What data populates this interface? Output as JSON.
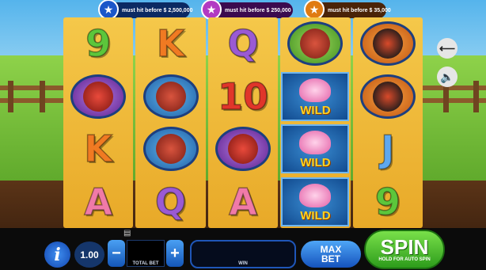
{
  "jackpots": [
    {
      "text": "must hit before $ 2,500,000",
      "color": "#1b57c9"
    },
    {
      "text": "must hit before $ 250,000",
      "color": "#b23ac2"
    },
    {
      "text": "must hit before $ 35,000",
      "color": "#e07b12"
    }
  ],
  "reels": [
    [
      {
        "type": "letter",
        "value": "9",
        "color": "green"
      },
      {
        "type": "symbol",
        "icon": "red-ant-icon"
      },
      {
        "type": "letter",
        "value": "K",
        "color": "orange"
      },
      {
        "type": "letter",
        "value": "A",
        "color": "pink"
      }
    ],
    [
      {
        "type": "letter",
        "value": "K",
        "color": "orange"
      },
      {
        "type": "symbol",
        "icon": "ant-icon"
      },
      {
        "type": "symbol",
        "icon": "ant-icon"
      },
      {
        "type": "letter",
        "value": "Q",
        "color": "purple"
      }
    ],
    [
      {
        "type": "letter",
        "value": "Q",
        "color": "purple"
      },
      {
        "type": "letter",
        "value": "10",
        "color": "red"
      },
      {
        "type": "symbol",
        "icon": "red-ant-icon"
      },
      {
        "type": "letter",
        "value": "A",
        "color": "pink"
      }
    ],
    [
      {
        "type": "symbol",
        "icon": "ant-with-lollipop-icon"
      },
      {
        "type": "wild",
        "label": "WILD"
      },
      {
        "type": "wild",
        "label": "WILD"
      },
      {
        "type": "wild",
        "label": "WILD"
      }
    ],
    [
      {
        "type": "symbol",
        "icon": "ladybug-icon"
      },
      {
        "type": "symbol",
        "icon": "ladybug-icon"
      },
      {
        "type": "letter",
        "value": "J",
        "color": "blue"
      },
      {
        "type": "letter",
        "value": "9",
        "color": "green"
      }
    ]
  ],
  "controls": {
    "info_label": "i",
    "bet_value": "1.00",
    "minus_label": "−",
    "plus_label": "+",
    "total_bet_label": "TOTAL BET",
    "win_label": "WIN",
    "max_bet_line1": "MAX",
    "max_bet_line2": "BET",
    "spin_label": "SPIN",
    "spin_sub": "HOLD FOR AUTO SPIN"
  },
  "side": {
    "back_icon": "arrow-left-icon",
    "sound_icon": "speaker-icon"
  }
}
